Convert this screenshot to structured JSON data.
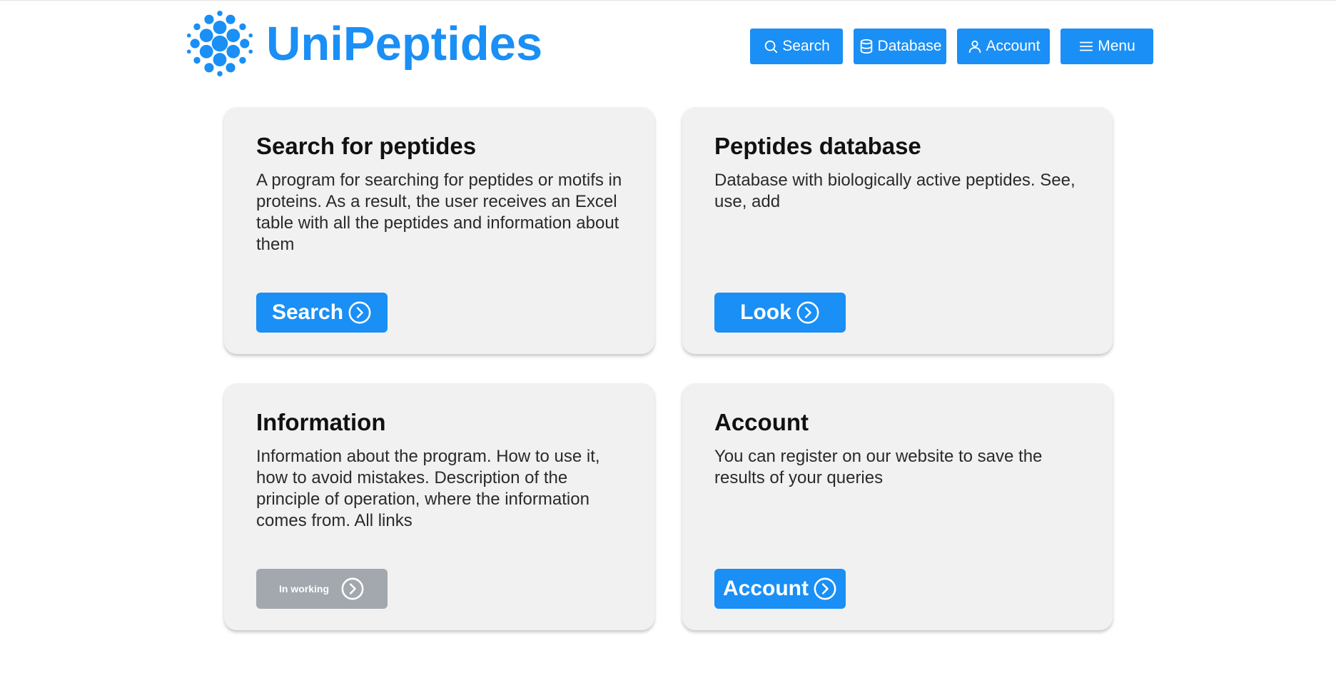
{
  "brand": {
    "name": "UniPeptides",
    "color": "#1a8ff5",
    "logo_icon": "peptide-sphere-icon"
  },
  "nav": [
    {
      "label": "Search",
      "icon": "search-icon"
    },
    {
      "label": "Database",
      "icon": "database-icon"
    },
    {
      "label": "Account",
      "icon": "user-icon"
    },
    {
      "label": "Menu",
      "icon": "hamburger-menu-icon"
    }
  ],
  "cards": [
    {
      "title": "Search for peptides",
      "description": "A program for searching for peptides or motifs in proteins. As a result, the user receives an Excel table with all the peptides and information about them",
      "button": "Search",
      "button_icon": "chevron-right-circle-icon",
      "enabled": true
    },
    {
      "title": "Peptides database",
      "description": "Database with biologically active peptides. See, use, add",
      "button": "Look",
      "button_icon": "chevron-right-circle-icon",
      "enabled": true
    },
    {
      "title": "Information",
      "description": "Information about the program. How to use it, how to avoid mistakes. Description of the principle of operation, where the information comes from. All links",
      "button": "In working",
      "button_icon": "chevron-right-circle-icon",
      "enabled": false
    },
    {
      "title": "Account",
      "description": "You can register on our website to save the results of your queries",
      "button": "Account",
      "button_icon": "chevron-right-circle-icon",
      "enabled": true
    }
  ],
  "colors": {
    "accent": "#1a8ff5",
    "disabled": "#a2a8ae",
    "card_bg": "#f1f1f1"
  }
}
